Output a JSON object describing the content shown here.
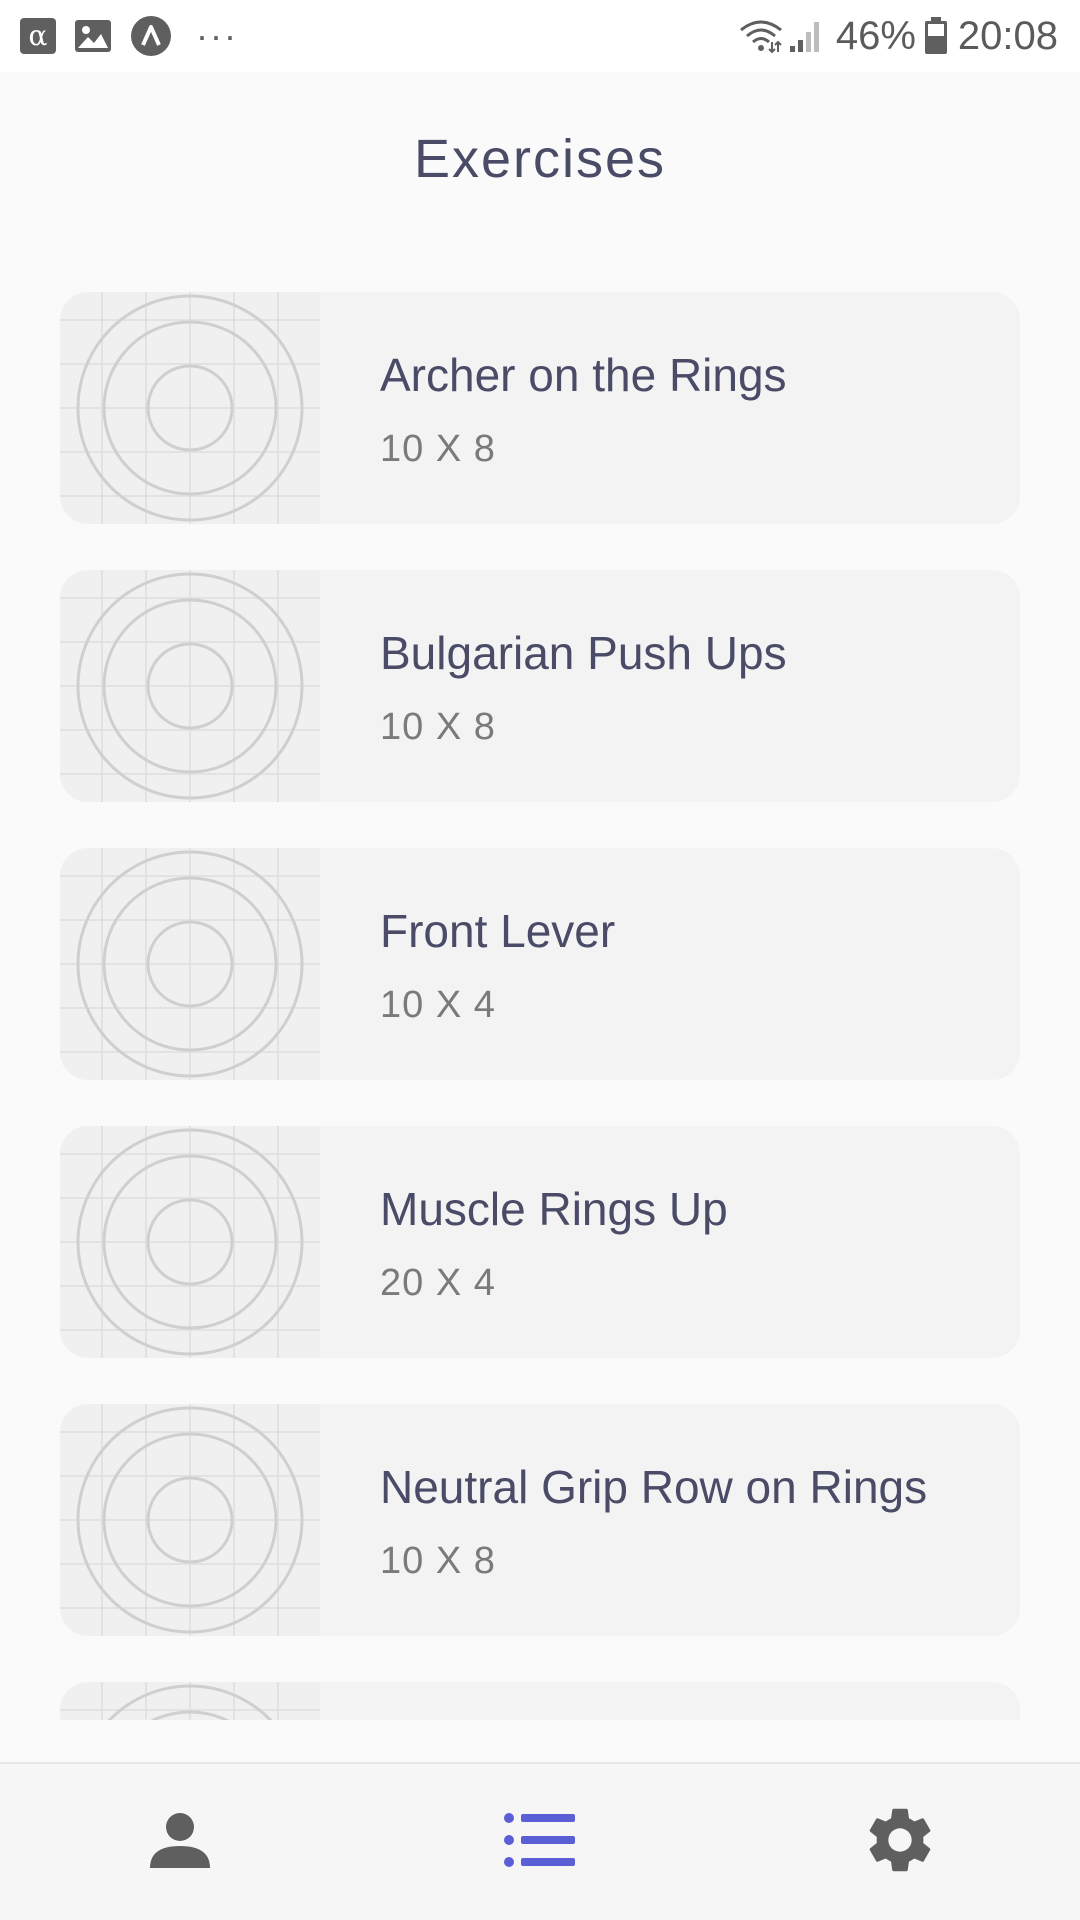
{
  "status_bar": {
    "alpha_icon_glyph": "α",
    "more_glyph": "···",
    "battery_percent": "46%",
    "time": "20:08",
    "icons": [
      "alpha-app-icon",
      "gallery-icon",
      "app-icon",
      "more-icon",
      "wifi-icon",
      "signal-icon",
      "battery-icon"
    ]
  },
  "header": {
    "title": "Exercises"
  },
  "exercises": [
    {
      "name": "Archer on the Rings",
      "sets": "10 X 8"
    },
    {
      "name": "Bulgarian Push Ups",
      "sets": "10 X 8"
    },
    {
      "name": "Front Lever",
      "sets": "10 X 4"
    },
    {
      "name": "Muscle Rings Up",
      "sets": "20 X 4"
    },
    {
      "name": "Neutral Grip Row on Rings",
      "sets": "10 X 8"
    }
  ],
  "bottom_nav": {
    "items": [
      {
        "icon": "person-icon",
        "active": false
      },
      {
        "icon": "list-icon",
        "active": true
      },
      {
        "icon": "gear-icon",
        "active": false
      }
    ]
  },
  "colors": {
    "accent": "#5a5fd6",
    "title": "#4a4b66",
    "inactive_icon": "#5f5f5f",
    "card_bg": "#f3f3f3"
  }
}
